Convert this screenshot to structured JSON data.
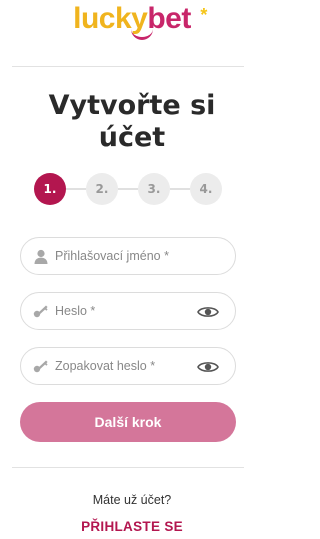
{
  "logo": {
    "part1": "lucky",
    "part2": "bet",
    "star": "*"
  },
  "title": {
    "line1": "Vytvořte si",
    "line2": "účet"
  },
  "steps": [
    {
      "label": "1.",
      "active": true
    },
    {
      "label": "2.",
      "active": false
    },
    {
      "label": "3.",
      "active": false
    },
    {
      "label": "4.",
      "active": false
    }
  ],
  "form": {
    "username": {
      "placeholder": "Přihlašovací jméno *",
      "icon": "user-icon"
    },
    "password": {
      "placeholder": "Heslo *",
      "icon": "key-icon",
      "toggle_icon": "eye-icon"
    },
    "password_repeat": {
      "placeholder": "Zopakovat heslo *",
      "icon": "key-icon",
      "toggle_icon": "eye-icon"
    },
    "next_button": "Další krok"
  },
  "footer": {
    "have_account": "Máte už účet?",
    "login_link": "PŘIHLASTE SE"
  },
  "colors": {
    "brand_primary": "#b3164f",
    "button": "#d4769a",
    "logo_yellow": "#f0b41e",
    "logo_pink": "#c8266a"
  }
}
